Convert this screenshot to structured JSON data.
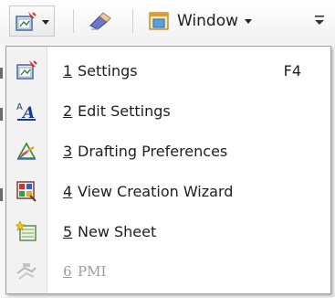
{
  "toolbar": {
    "window_label": "Window"
  },
  "menu": {
    "items": [
      {
        "number": "1",
        "label": "Settings",
        "shortcut": "F4",
        "icon": "settings-icon",
        "enabled": true
      },
      {
        "number": "2",
        "label": "Edit Settings",
        "shortcut": "",
        "icon": "edit-settings-icon",
        "enabled": true
      },
      {
        "number": "3",
        "label": "Drafting Preferences",
        "shortcut": "",
        "icon": "drafting-preferences-icon",
        "enabled": true
      },
      {
        "number": "4",
        "label": "View Creation Wizard",
        "shortcut": "",
        "icon": "view-creation-wizard-icon",
        "enabled": true
      },
      {
        "number": "5",
        "label": "New Sheet",
        "shortcut": "",
        "icon": "new-sheet-icon",
        "enabled": true
      },
      {
        "number": "6",
        "label": "PMI",
        "shortcut": "",
        "icon": "pmi-icon",
        "enabled": false
      }
    ]
  }
}
